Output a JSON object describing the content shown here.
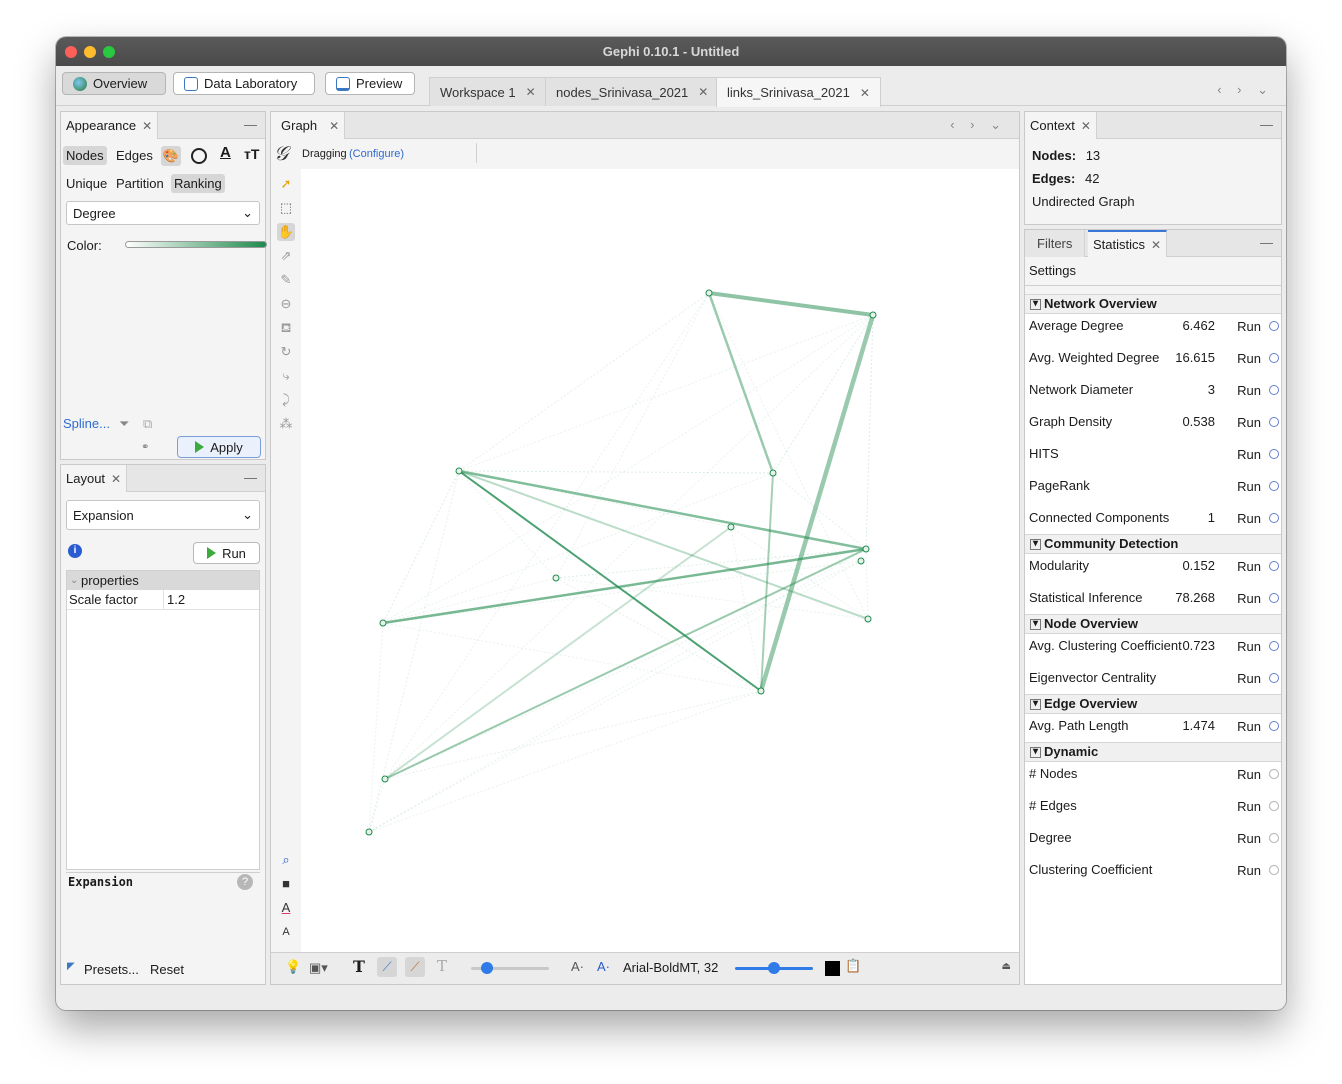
{
  "window": {
    "title": "Gephi 0.10.1 - Untitled"
  },
  "modes": [
    {
      "label": "Overview",
      "active": true
    },
    {
      "label": "Data Laboratory",
      "active": false
    },
    {
      "label": "Preview",
      "active": false
    }
  ],
  "workspaces": [
    {
      "label": "Workspace 1",
      "active": false
    },
    {
      "label": "nodes_Srinivasa_2021",
      "active": false
    },
    {
      "label": "links_Srinivasa_2021",
      "active": true
    }
  ],
  "appearance": {
    "tab": "Appearance",
    "element_tabs": [
      "Nodes",
      "Edges"
    ],
    "modes": [
      "Unique",
      "Partition",
      "Ranking"
    ],
    "attribute": "Degree",
    "color_label": "Color:",
    "spline_label": "Spline...",
    "apply_label": "Apply",
    "gradient": [
      "#ffffff",
      "#1e8a4c"
    ]
  },
  "layout": {
    "tab": "Layout",
    "algorithm": "Expansion",
    "run_label": "Run",
    "properties_header": "properties",
    "properties": [
      {
        "name": "Scale factor",
        "value": "1.2"
      }
    ],
    "description_title": "Expansion",
    "presets_label": "Presets...",
    "reset_label": "Reset"
  },
  "graph": {
    "tab": "Graph",
    "tool_label": "Dragging",
    "configure_label": "(Configure)",
    "font_label": "Arial-BoldMT, 32",
    "edge_color": "#1e8a4c"
  },
  "context": {
    "tab": "Context",
    "nodes_label": "Nodes:",
    "nodes_value": "13",
    "edges_label": "Edges:",
    "edges_value": "42",
    "graph_type": "Undirected Graph"
  },
  "statistics": {
    "tabs": [
      "Filters",
      "Statistics"
    ],
    "settings_label": "Settings",
    "sections": [
      {
        "title": "Network Overview",
        "rows": [
          {
            "label": "Average Degree",
            "value": "6.462",
            "run": "Run"
          },
          {
            "label": "Avg. Weighted Degree",
            "value": "16.615",
            "run": "Run"
          },
          {
            "label": "Network Diameter",
            "value": "3",
            "run": "Run"
          },
          {
            "label": "Graph Density",
            "value": "0.538",
            "run": "Run"
          },
          {
            "label": "HITS",
            "value": "",
            "run": "Run"
          },
          {
            "label": "PageRank",
            "value": "",
            "run": "Run"
          },
          {
            "label": "Connected Components",
            "value": "1",
            "run": "Run"
          }
        ]
      },
      {
        "title": "Community Detection",
        "rows": [
          {
            "label": "Modularity",
            "value": "0.152",
            "run": "Run"
          },
          {
            "label": "Statistical Inference",
            "value": "78.268",
            "run": "Run"
          }
        ]
      },
      {
        "title": "Node Overview",
        "rows": [
          {
            "label": "Avg. Clustering Coefficient",
            "value": "0.723",
            "run": "Run"
          },
          {
            "label": "Eigenvector Centrality",
            "value": "",
            "run": "Run"
          }
        ]
      },
      {
        "title": "Edge Overview",
        "rows": [
          {
            "label": "Avg. Path Length",
            "value": "1.474",
            "run": "Run"
          }
        ]
      },
      {
        "title": "Dynamic",
        "rows": [
          {
            "label": "# Nodes",
            "value": "",
            "run": "Run"
          },
          {
            "label": "# Edges",
            "value": "",
            "run": "Run"
          },
          {
            "label": "Degree",
            "value": "",
            "run": "Run"
          },
          {
            "label": "Clustering Coefficient",
            "value": "",
            "run": "Run"
          }
        ]
      }
    ]
  }
}
